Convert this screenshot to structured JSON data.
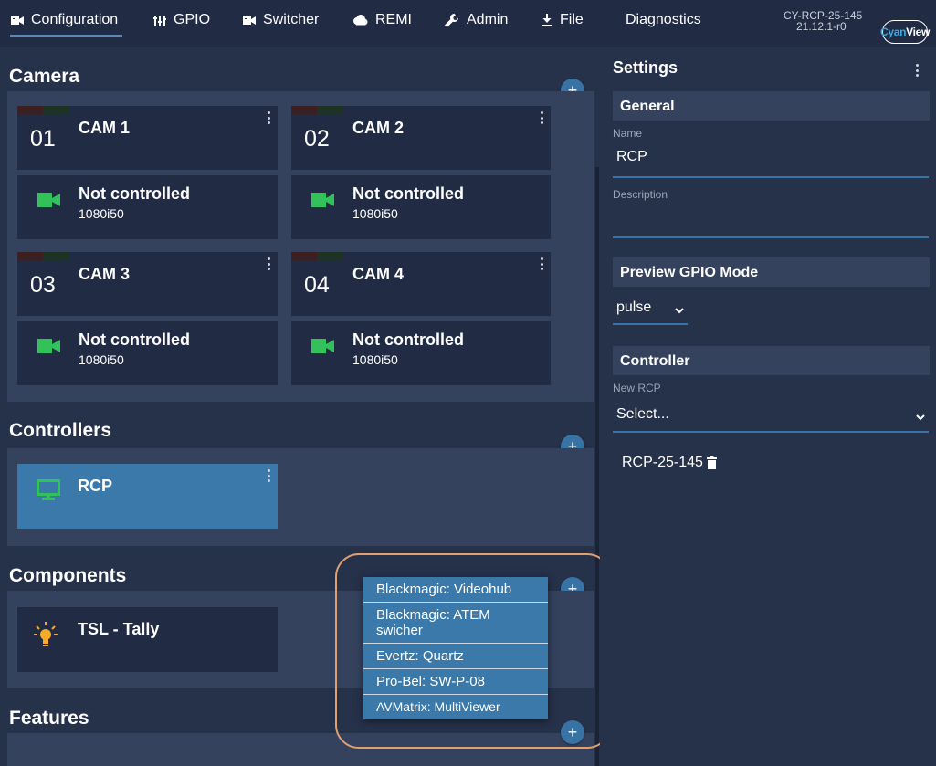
{
  "nav": {
    "items": [
      {
        "label": "Configuration",
        "icon": "video-camera-icon"
      },
      {
        "label": "GPIO",
        "icon": "gpio-sliders-icon"
      },
      {
        "label": "Switcher",
        "icon": "video-camera-icon"
      },
      {
        "label": "REMI",
        "icon": "cloud-icon"
      },
      {
        "label": "Admin",
        "icon": "wrench-icon"
      },
      {
        "label": "File",
        "icon": "download-icon"
      },
      {
        "label": "Diagnostics"
      }
    ],
    "device_name": "CY-RCP-25-145",
    "device_version": "21.12.1-r0",
    "brand_a": "Cyan",
    "brand_b": "View"
  },
  "camera": {
    "title": "Camera",
    "add_label": "+",
    "cards": [
      {
        "number": "01",
        "name": "CAM 1",
        "status": "Not controlled",
        "format": "1080i50"
      },
      {
        "number": "02",
        "name": "CAM 2",
        "status": "Not controlled",
        "format": "1080i50"
      },
      {
        "number": "03",
        "name": "CAM 3",
        "status": "Not controlled",
        "format": "1080i50"
      },
      {
        "number": "04",
        "name": "CAM 4",
        "status": "Not controlled",
        "format": "1080i50"
      }
    ]
  },
  "controllers": {
    "title": "Controllers",
    "add_label": "+",
    "items": [
      {
        "name": "RCP"
      }
    ]
  },
  "components": {
    "title": "Components",
    "add_label": "+",
    "items": [
      {
        "name": "TSL - Tally"
      }
    ],
    "menu": [
      "Blackmagic: Videohub",
      "Blackmagic: ATEM swicher",
      "Evertz: Quartz",
      "Pro-Bel: SW-P-08",
      "AVMatrix: MultiViewer"
    ]
  },
  "features": {
    "title": "Features",
    "add_label": "+"
  },
  "settings": {
    "title": "Settings",
    "general_header": "General",
    "name_label": "Name",
    "name_value": "RCP",
    "description_label": "Description",
    "description_value": "",
    "gpio_header": "Preview GPIO Mode",
    "gpio_value": "pulse",
    "controller_header": "Controller",
    "new_rcp_label": "New RCP",
    "new_rcp_value": "Select...",
    "rcp_item": "RCP-25-145"
  },
  "colors": {
    "background": "#26314a",
    "card": "#212b43",
    "section": "#34425e",
    "accent": "#3873a6",
    "selected": "#3a79a9",
    "status_green": "#33c15c",
    "tally_yellow": "#f7a928"
  }
}
